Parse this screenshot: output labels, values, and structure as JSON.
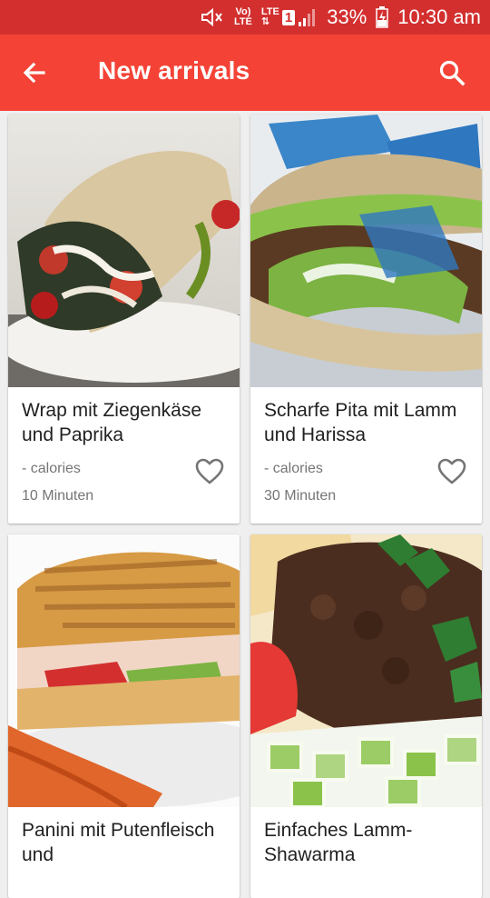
{
  "status_bar": {
    "network_label_top": "Vo)",
    "network_label_bottom": "LTE",
    "lte_label": "LTE",
    "sim_number": "1",
    "battery": "33%",
    "time": "10:30 am"
  },
  "app_bar": {
    "title": "New arrivals",
    "back_icon": "arrow-back-icon",
    "search_icon": "search-icon"
  },
  "colors": {
    "status_bar": "#d32f2f",
    "app_bar": "#f44336",
    "background": "#efefef"
  },
  "recipes": [
    {
      "name": "Wrap mit Ziegenkäse und Paprika",
      "calories": "- calories",
      "time": "10 Minuten",
      "favorite_icon": "heart-outline-icon"
    },
    {
      "name": "Scharfe Pita mit Lamm und Harissa",
      "calories": "- calories",
      "time": "30 Minuten",
      "favorite_icon": "heart-outline-icon"
    },
    {
      "name": "Panini mit Putenfleisch und",
      "favorite_icon": "heart-outline-icon"
    },
    {
      "name": "Einfaches Lamm-Shawarma",
      "favorite_icon": "heart-outline-icon"
    }
  ]
}
